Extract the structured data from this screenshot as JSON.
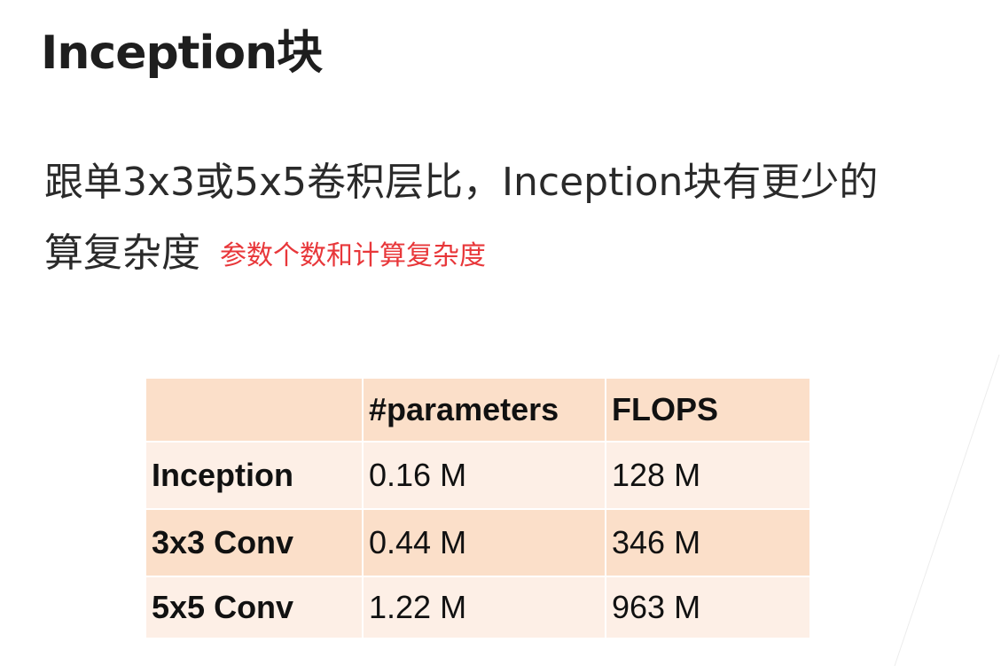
{
  "slide": {
    "title": "Inception块",
    "line1": "跟单3x3或5x5卷积层比，Inception块有更少的",
    "line2": "算复杂度",
    "annotation": "参数个数和计算复杂度"
  },
  "table": {
    "columns": [
      "",
      "#parameters",
      "FLOPS"
    ],
    "rows": [
      [
        "Inception",
        "0.16 M",
        "128 M"
      ],
      [
        "3x3 Conv",
        "0.44 M",
        "346 M"
      ],
      [
        "5x5 Conv",
        "1.22 M",
        "963 M"
      ]
    ]
  },
  "colors": {
    "annotation": "#e8373a",
    "table_header_bg": "#fbdfc9",
    "table_row_light_bg": "#fdefe6",
    "table_row_dark_bg": "#fbdfc9"
  }
}
